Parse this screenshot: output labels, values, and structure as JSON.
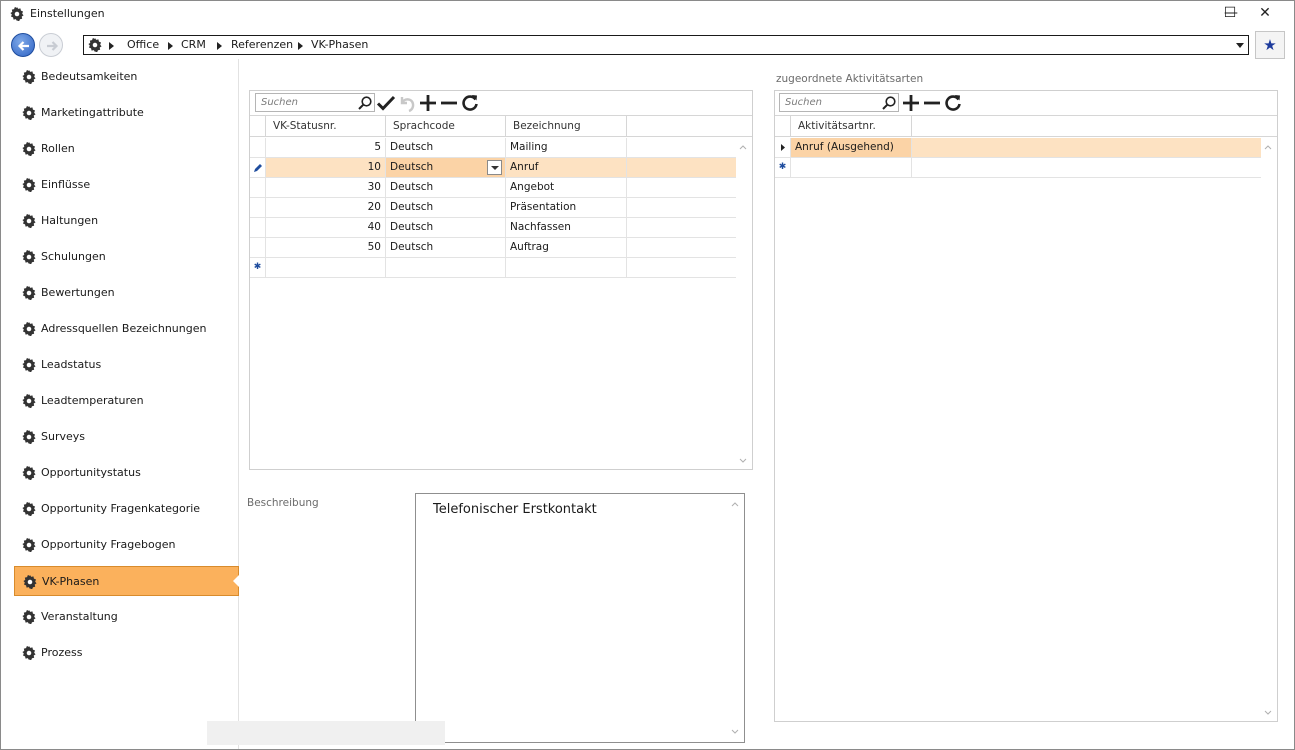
{
  "window": {
    "title": "Einstellungen",
    "minimize": "—",
    "maximize": "☐",
    "close": "✕"
  },
  "breadcrumb": {
    "items": [
      "Office",
      "CRM",
      "Referenzen",
      "VK-Phasen"
    ]
  },
  "sidebar": {
    "items": [
      {
        "label": "Bedeutsamkeiten"
      },
      {
        "label": "Marketingattribute"
      },
      {
        "label": "Rollen"
      },
      {
        "label": "Einflüsse"
      },
      {
        "label": "Haltungen"
      },
      {
        "label": "Schulungen"
      },
      {
        "label": "Bewertungen"
      },
      {
        "label": "Adressquellen Bezeichnungen"
      },
      {
        "label": "Leadstatus"
      },
      {
        "label": "Leadtemperaturen"
      },
      {
        "label": "Surveys"
      },
      {
        "label": "Opportunitystatus"
      },
      {
        "label": "Opportunity Fragenkategorie"
      },
      {
        "label": "Opportunity Fragebogen"
      },
      {
        "label": "VK-Phasen"
      },
      {
        "label": "Veranstaltung"
      },
      {
        "label": "Prozess"
      }
    ],
    "active": "VK-Phasen"
  },
  "phases": {
    "search_placeholder": "Suchen",
    "columns": [
      "VK-Statusnr.",
      "Sprachcode",
      "Bezeichnung"
    ],
    "rows": [
      {
        "nr": "5",
        "lang": "Deutsch",
        "name": "Mailing"
      },
      {
        "nr": "10",
        "lang": "Deutsch",
        "name": "Anruf"
      },
      {
        "nr": "30",
        "lang": "Deutsch",
        "name": "Angebot"
      },
      {
        "nr": "20",
        "lang": "Deutsch",
        "name": "Präsentation"
      },
      {
        "nr": "40",
        "lang": "Deutsch",
        "name": "Nachfassen"
      },
      {
        "nr": "50",
        "lang": "Deutsch",
        "name": "Auftrag"
      }
    ],
    "current_row": 1,
    "new_row_marker": "✱"
  },
  "activities": {
    "title": "zugeordnete Aktivitätsarten",
    "search_placeholder": "Suchen",
    "columns": [
      "Aktivitätsartnr."
    ],
    "rows": [
      {
        "value": "Anruf (Ausgehend)"
      }
    ],
    "new_row_marker": "✱"
  },
  "description": {
    "label": "Beschreibung",
    "text": "Telefonischer Erstkontakt"
  },
  "colors": {
    "accent": "#fbb15c",
    "selected_row": "#fde2c2",
    "nav_blue": "#2d62c4"
  }
}
